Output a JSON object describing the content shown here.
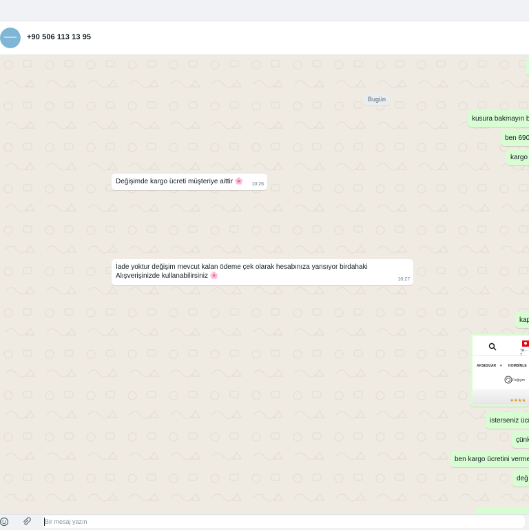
{
  "contact": {
    "phone": "+90 506 113 13 95",
    "avatar_icon": "avatar-icon"
  },
  "date_chip": "Bugün",
  "messages": [
    {
      "dir": "out",
      "text": "kusura bakmayın b"
    },
    {
      "dir": "out",
      "text": "ben 690"
    },
    {
      "dir": "out",
      "text": "kargo"
    },
    {
      "dir": "in",
      "text": "Değişimde kargo ücreti müşteriye aittir 🌸",
      "time": "10:26"
    },
    {
      "dir": "in",
      "text": "İade yoktur değişim mevcut kalan ödeme çek olarak hesabınıza yansıyor birdahaki Alışverişinizde kullanabilirsiniz 🌸",
      "time": "10:27"
    },
    {
      "dir": "out",
      "text": "kap"
    },
    {
      "dir": "out",
      "text": "isterseniz ücr"
    },
    {
      "dir": "out",
      "text": "çünk"
    },
    {
      "dir": "out",
      "text": "ben kargo ücretini verme"
    },
    {
      "dir": "out",
      "text": "değ"
    }
  ],
  "embed": {
    "flag_label": "TR - T",
    "nav_items": [
      "AKSESUAR",
      "KOMBİNLE"
    ],
    "exchange_text": "Değişim",
    "stars": "★★★★"
  },
  "input": {
    "placeholder": "Bir mesaj yazın"
  },
  "colors": {
    "incoming": "#ffffff",
    "outgoing": "#d9fdd3",
    "chat_bg": "#efeae2"
  }
}
